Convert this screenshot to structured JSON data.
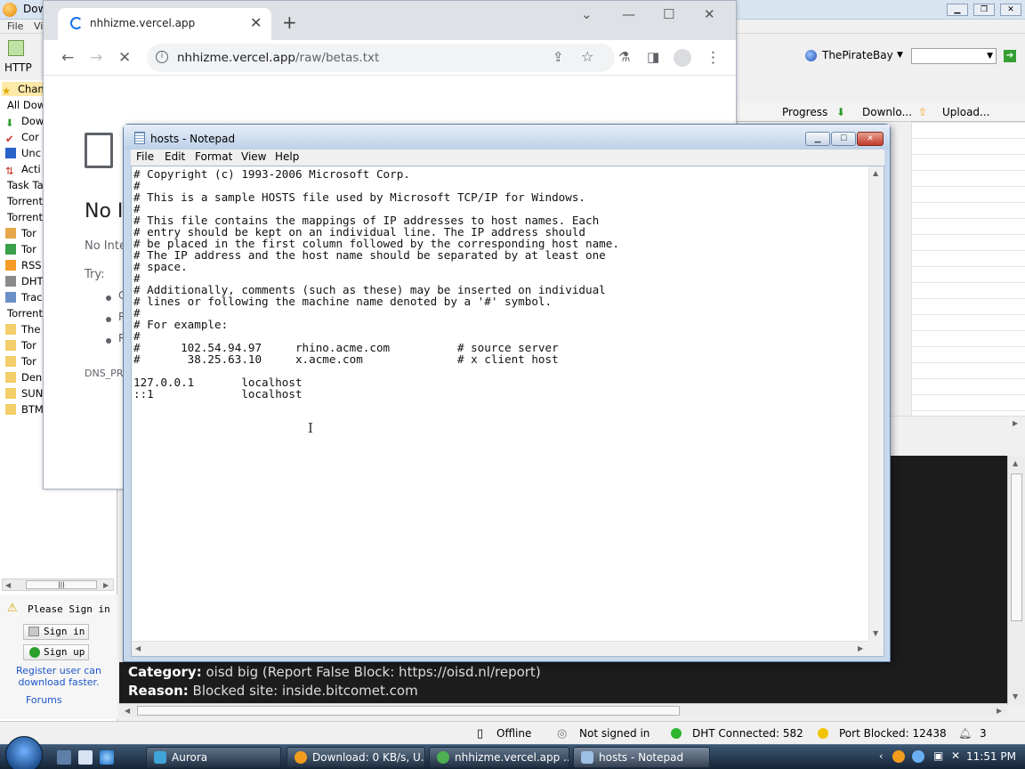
{
  "bitcomet": {
    "title": "Dow",
    "menu": [
      "File",
      "Vi"
    ],
    "toolbar": {
      "http_label": "HTTP",
      "search_site": "ThePirateBay"
    },
    "sidebar_items": [
      {
        "label": "Chan",
        "icon": "star-icon"
      },
      {
        "label": "All Dow",
        "icon": ""
      },
      {
        "label": "Dow",
        "icon": "arrow-down-icon"
      },
      {
        "label": "Cor",
        "icon": "check-icon"
      },
      {
        "label": "Unc",
        "icon": "square-icon"
      },
      {
        "label": "Acti",
        "icon": "arrows-icon"
      },
      {
        "label": "Task Ta",
        "icon": ""
      },
      {
        "label": "Torrent",
        "icon": ""
      },
      {
        "label": "Torrent",
        "icon": ""
      },
      {
        "label": "Tor",
        "icon": "torrent-icon"
      },
      {
        "label": "Tor",
        "icon": "torrent-icon"
      },
      {
        "label": "RSS",
        "icon": "rss-icon"
      },
      {
        "label": "DHT",
        "icon": "dht-icon"
      },
      {
        "label": "Trac",
        "icon": "tracker-icon"
      },
      {
        "label": "Torrent",
        "icon": ""
      },
      {
        "label": "The",
        "icon": "folder-icon"
      },
      {
        "label": "Tor",
        "icon": "folder-icon"
      },
      {
        "label": "Tor",
        "icon": "folder-icon"
      },
      {
        "label": "Den",
        "icon": "folder-icon"
      },
      {
        "label": "SUN",
        "icon": "folder-icon"
      },
      {
        "label": "BTM",
        "icon": "folder-icon"
      }
    ],
    "columns": [
      "Progress",
      "Downlo...",
      "Upload..."
    ],
    "signin": {
      "notice": "Please Sign in",
      "sign_in": "Sign in",
      "sign_up": "Sign up",
      "register_line1": "Register user can",
      "register_line2": "download faster.",
      "forums": "Forums"
    },
    "info": {
      "category_label": "Category:",
      "category_value": " oisd big (Report False Block: https://oisd.nl/report)",
      "reason_label": "Reason:",
      "reason_value": " Blocked site: inside.bitcomet.com"
    },
    "status": {
      "offline": "Offline",
      "signin": "Not signed in",
      "dht": "DHT Connected: 582",
      "port": "Port Blocked: 12438",
      "count": "3"
    },
    "colors": {
      "dht_dot": "#2fb52f",
      "port_dot": "#f2c300",
      "info_bg": "#1c1c1c"
    }
  },
  "chrome": {
    "tab_title": "nhhizme.vercel.app",
    "url_host": "nhhizme.vercel.app",
    "url_path": "/raw/betas.txt",
    "error": {
      "title": "No I",
      "subtitle": "No Inte",
      "try": "Try:",
      "bullets": [
        "C",
        "R",
        "R"
      ],
      "code": "DNS_PR"
    }
  },
  "notepad": {
    "title": "hosts - Notepad",
    "menu": [
      "File",
      "Edit",
      "Format",
      "View",
      "Help"
    ],
    "lines": [
      "# Copyright (c) 1993-2006 Microsoft Corp.",
      "#",
      "# This is a sample HOSTS file used by Microsoft TCP/IP for Windows.",
      "#",
      "# This file contains the mappings of IP addresses to host names. Each",
      "# entry should be kept on an individual line. The IP address should",
      "# be placed in the first column followed by the corresponding host name.",
      "# The IP address and the host name should be separated by at least one",
      "# space.",
      "#",
      "# Additionally, comments (such as these) may be inserted on individual",
      "# lines or following the machine name denoted by a '#' symbol.",
      "#",
      "# For example:",
      "#",
      "#      102.54.94.97     rhino.acme.com          # source server",
      "#       38.25.63.10     x.acme.com              # x client host",
      "",
      "127.0.0.1       localhost",
      "::1             localhost"
    ]
  },
  "taskbar": {
    "tasks": [
      {
        "label": "Aurora",
        "color": "#3fa4d8"
      },
      {
        "label": "Download: 0 KB/s, U...",
        "color": "#f29b1d"
      },
      {
        "label": "nhhizme.vercel.app ...",
        "color": "#4caf50"
      },
      {
        "label": "hosts - Notepad",
        "color": "#9fc0e6"
      }
    ],
    "clock": "11:51 PM"
  }
}
